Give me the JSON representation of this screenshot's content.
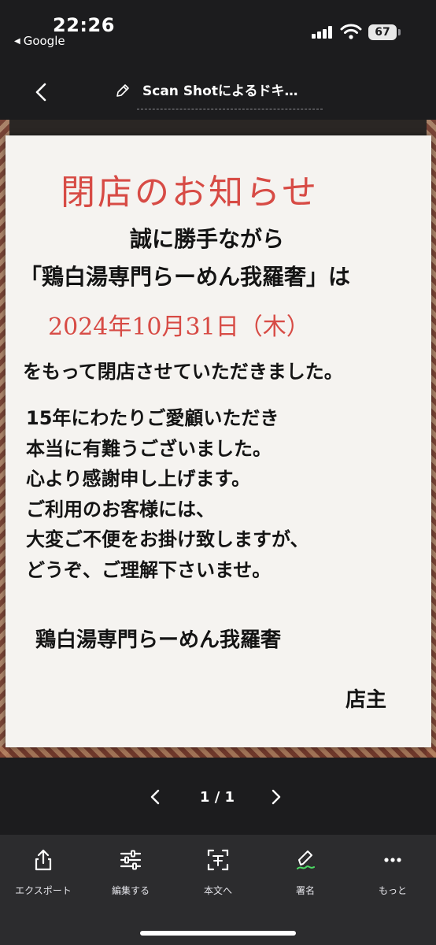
{
  "status_bar": {
    "time": "22:26",
    "back_app": "Google",
    "battery": "67"
  },
  "nav": {
    "title": "Scan Shotによるドキ…"
  },
  "notice": {
    "title": "閉店のお知らせ",
    "line1": "誠に勝手ながら",
    "line2": "「鶏白湯専門らーめん我羅奢」は",
    "date": "2024年10月31日（木）",
    "line3": "をもって閉店させていただきました。",
    "body": [
      "15年にわたりご愛顧いただき",
      "本当に有難うございました。",
      "心より感謝申し上げます。",
      "ご利用のお客様には、",
      "大変ご不便をお掛け致しますが、",
      "どうぞ、ご理解下さいませ。"
    ],
    "shop_name": "鶏白湯専門らーめん我羅奢",
    "owner": "店主"
  },
  "pager": {
    "count": "1 / 1"
  },
  "toolbar": {
    "items": [
      {
        "label": "エクスポート",
        "icon": "export-icon"
      },
      {
        "label": "編集する",
        "icon": "sliders-icon"
      },
      {
        "label": "本文へ",
        "icon": "text-scan-icon"
      },
      {
        "label": "署名",
        "icon": "signature-icon"
      },
      {
        "label": "もっと",
        "icon": "more-icon"
      }
    ]
  },
  "colors": {
    "background": "#1c1c1e",
    "toolbar": "#2c2c2e",
    "notice_red": "#d74b45",
    "signature_accent": "#4cd964"
  }
}
